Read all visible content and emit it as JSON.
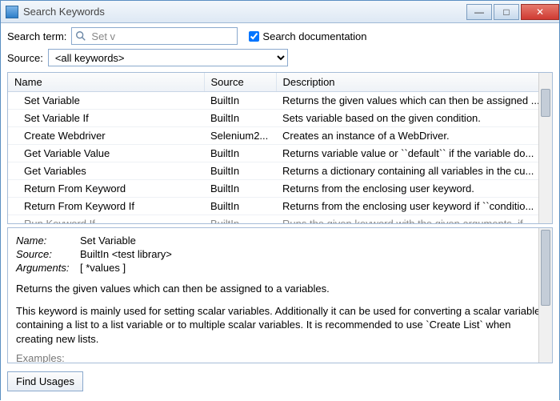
{
  "window": {
    "title": "Search Keywords"
  },
  "search": {
    "label": "Search term:",
    "value": "Set v",
    "docs_label": "Search documentation",
    "docs_checked": true
  },
  "source": {
    "label": "Source:",
    "selected": "<all keywords>"
  },
  "table": {
    "columns": {
      "name": "Name",
      "source": "Source",
      "description": "Description"
    },
    "rows": [
      {
        "name": "Set Variable",
        "source": "BuiltIn",
        "description": "Returns the given values which can then be assigned ..."
      },
      {
        "name": "Set Variable If",
        "source": "BuiltIn",
        "description": "Sets variable based on the given condition."
      },
      {
        "name": "Create Webdriver",
        "source": "Selenium2...",
        "description": "Creates an instance of a WebDriver."
      },
      {
        "name": "Get Variable Value",
        "source": "BuiltIn",
        "description": "Returns variable value or ``default`` if the variable do..."
      },
      {
        "name": "Get Variables",
        "source": "BuiltIn",
        "description": "Returns a dictionary containing all variables in the cu..."
      },
      {
        "name": "Return From Keyword",
        "source": "BuiltIn",
        "description": "Returns from the enclosing user keyword."
      },
      {
        "name": "Return From Keyword If",
        "source": "BuiltIn",
        "description": "Returns from the enclosing user keyword if ``conditio..."
      },
      {
        "name": "Run Keyword If",
        "source": "BuiltIn",
        "description": "Runs the given keyword with the given arguments, if ..."
      }
    ]
  },
  "detail": {
    "name_label": "Name:",
    "name": "Set Variable",
    "source_label": "Source:",
    "source": "BuiltIn <test library>",
    "args_label": "Arguments:",
    "args": "[ *values ]",
    "para1": "Returns the given values which can then be assigned to a variables.",
    "para2": "This keyword is mainly used for setting scalar variables. Additionally it can be used for converting a scalar variable containing a list to a list variable or to multiple scalar variables. It is recommended to use `Create List` when creating new lists.",
    "examples_label": "Examples:"
  },
  "footer": {
    "find_usages": "Find Usages"
  }
}
